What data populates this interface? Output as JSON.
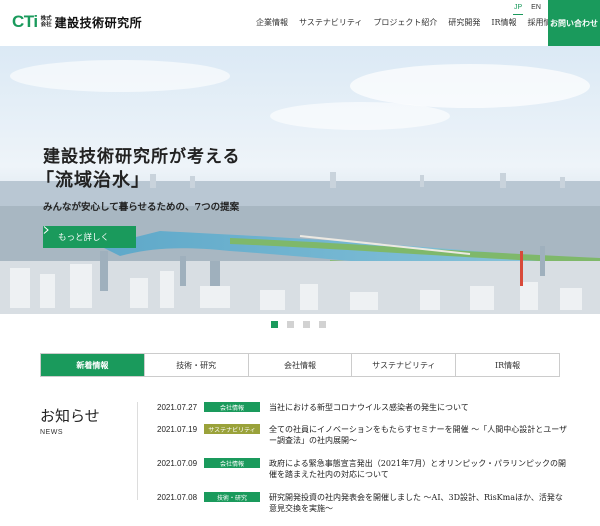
{
  "header": {
    "logo": {
      "mark": "CTi",
      "company_type_1": "株式",
      "company_type_2": "会社",
      "name": "建設技術研究所"
    },
    "nav": [
      "企業情報",
      "サステナビリティ",
      "プロジェクト紹介",
      "研究開発",
      "IR情報",
      "採用情報"
    ],
    "lang": {
      "jp": "JP",
      "en": "EN"
    },
    "contact_label": "お問い合わせ"
  },
  "hero": {
    "title_line1": "建設技術研究所が考える",
    "title_line2": "「流域治水」",
    "subtitle": "みんなが安心して暮らせるための、7つの提案",
    "button_label": "もっと詳しく",
    "button_icon": "chevron-right-icon",
    "slides": 4,
    "active_slide": 1
  },
  "tabs": [
    {
      "label": "新着情報",
      "active": true
    },
    {
      "label": "技術・研究",
      "active": false
    },
    {
      "label": "会社情報",
      "active": false
    },
    {
      "label": "サステナビリティ",
      "active": false
    },
    {
      "label": "IR情報",
      "active": false
    }
  ],
  "news": {
    "heading": "お知らせ",
    "subheading": "NEWS",
    "items": [
      {
        "date": "2021.07.27",
        "badge": "会社情報",
        "badge_color": "#1a9a5c",
        "title": "当社における新型コロナウイルス感染者の発生について"
      },
      {
        "date": "2021.07.19",
        "badge": "サステナビリティ",
        "badge_color": "#9aa23a",
        "title": "全ての社員にイノベーションをもたらすセミナーを開催 〜「人間中心設計とユーザー調査法」の社内展開〜"
      },
      {
        "date": "2021.07.09",
        "badge": "会社情報",
        "badge_color": "#1a9a5c",
        "title": "政府による緊急事態宣言発出（2021年7月）とオリンピック・パラリンピックの開催を踏まえた社内の対応について"
      },
      {
        "date": "2021.07.08",
        "badge": "技術・研究",
        "badge_color": "#1a9a5c",
        "title": "研究開発投資の社内発表会を開催しました 〜AI、3D設計、RisKmaほか、活発な意見交換を実施〜"
      }
    ]
  },
  "colors": {
    "accent": "#1a9a5c",
    "olive": "#9aa23a"
  }
}
